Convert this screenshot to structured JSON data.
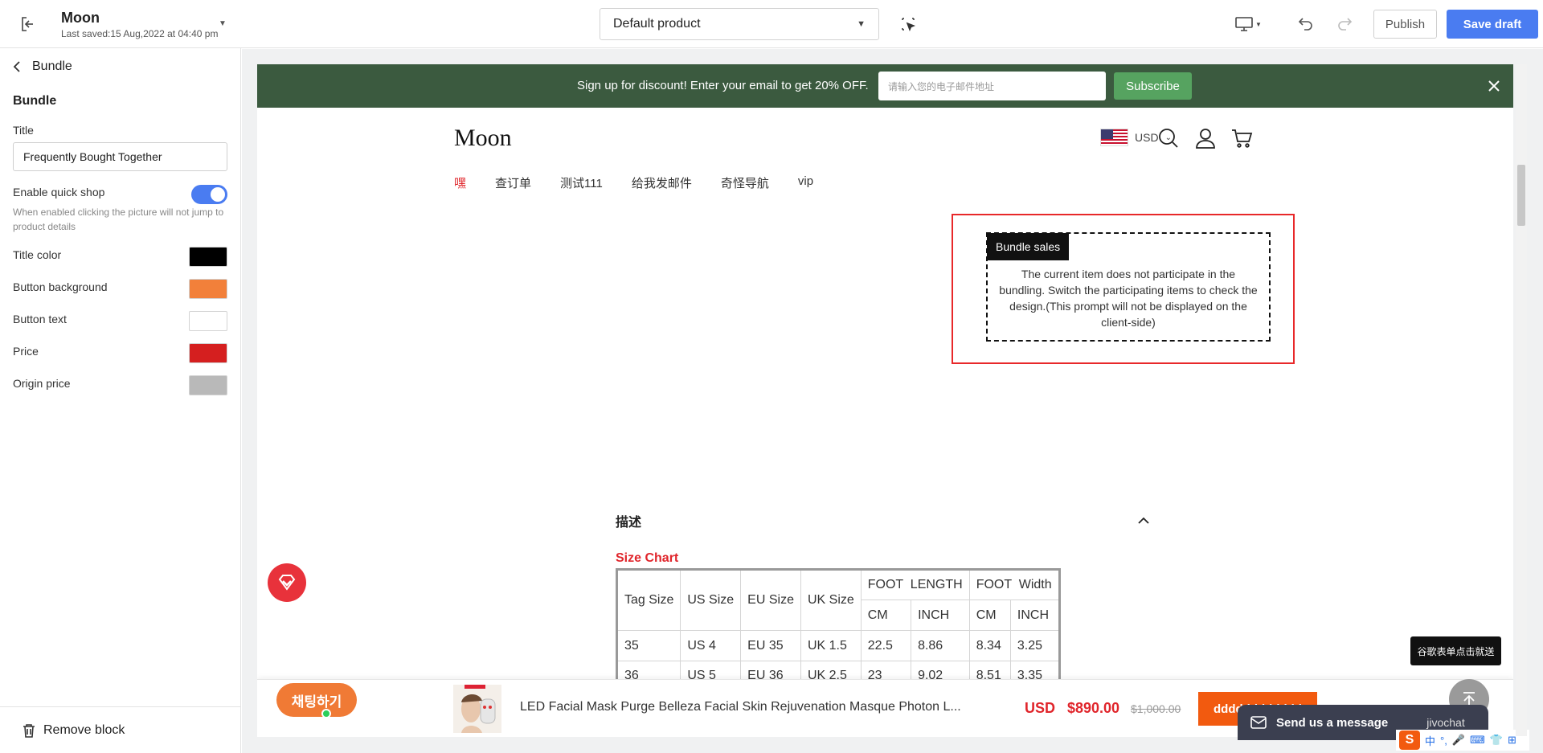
{
  "header": {
    "store_name": "Moon",
    "last_saved": "Last saved:15 Aug,2022 at 04:40 pm",
    "template_select": "Default product",
    "publish_label": "Publish",
    "save_label": "Save draft"
  },
  "sidebar": {
    "back_label": "Bundle",
    "section_title": "Bundle",
    "title_label": "Title",
    "title_value": "Frequently Bought Together",
    "quick_shop_label": "Enable quick shop",
    "quick_shop_enabled": true,
    "quick_shop_help": "When enabled clicking the picture will not jump to product details",
    "colors": [
      {
        "label": "Title color",
        "value": "#000000"
      },
      {
        "label": "Button background",
        "value": "#f2803a"
      },
      {
        "label": "Button text",
        "value": "#ffffff"
      },
      {
        "label": "Price",
        "value": "#d51f1f"
      },
      {
        "label": "Origin price",
        "value": "#b9b9b9"
      }
    ],
    "remove_label": "Remove block"
  },
  "preview": {
    "promo_text": "Sign up for discount! Enter your email to get 20% OFF.",
    "promo_placeholder": "请输入您的电子邮件地址",
    "subscribe_label": "Subscribe",
    "logo": "Moon",
    "currency": "USD",
    "nav": [
      "嘿",
      "查订单",
      "测试111",
      "给我发邮件",
      "奇怪导航",
      "vip"
    ],
    "bundle_tag": "Bundle sales",
    "bundle_message": "The current item does not participate in the bundling. Switch the participating items to check the design.(This prompt will not be displayed on the client-side)",
    "description_title": "描述",
    "size_chart_title": "Size Chart",
    "size_table": {
      "head": [
        "Tag Size",
        "US Size",
        "EU Size",
        "UK Size",
        "FOOT  LENGTH",
        "FOOT  Width"
      ],
      "subhead": [
        "CM",
        "INCH",
        "CM",
        "INCH"
      ],
      "rows": [
        [
          "35",
          "US 4",
          "EU 35",
          "UK 1.5",
          "22.5",
          "8.86",
          "8.34",
          "3.25"
        ],
        [
          "36",
          "US 5",
          "EU 36",
          "UK 2.5",
          "23",
          "9.02",
          "8.51",
          "3.35"
        ]
      ]
    },
    "bottom_bar": {
      "chat_label": "채팅하기",
      "product_name": "LED Facial Mask Purge Belleza Facial Skin Rejuvenation Masque Photon L...",
      "price": "USD  $890.00",
      "origin_price": "$1,000.00",
      "add_label": "dddddddddddd"
    },
    "google_form_label": "谷歌表单点击就送",
    "jivo_message": "Send us a message",
    "jivo_brand": "jivochat",
    "ime_items": [
      "S",
      "中",
      "°,",
      "🎤",
      "⌨",
      "👕",
      "⊞"
    ]
  },
  "icons": {
    "exit": "exit-icon",
    "inspect": "inspect-icon",
    "device": "desktop-icon",
    "undo": "undo-icon",
    "redo": "redo-icon",
    "search": "search-icon",
    "account": "user-icon",
    "cart": "cart-icon"
  }
}
